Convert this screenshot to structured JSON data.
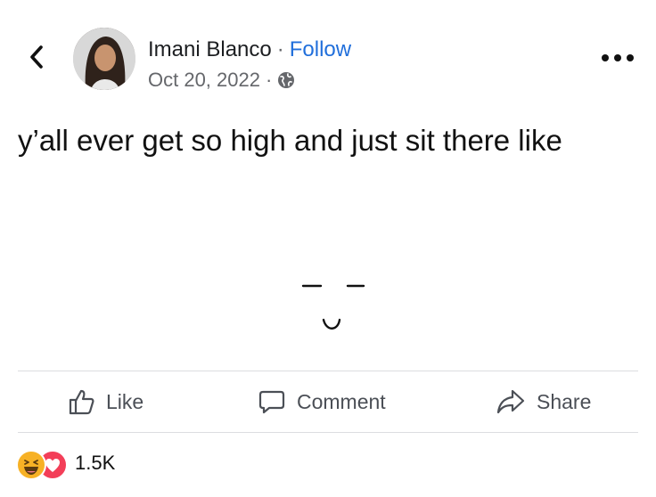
{
  "post": {
    "author": "Imani Blanco",
    "separator": "·",
    "follow_label": "Follow",
    "date": "Oct 20, 2022",
    "date_separator": "·",
    "privacy_icon": "globe-icon",
    "text": "y’all ever get so high and just sit there like"
  },
  "actions": {
    "like_label": "Like",
    "comment_label": "Comment",
    "share_label": "Share"
  },
  "reactions": {
    "count": "1.5K",
    "types": [
      "haha",
      "love"
    ]
  },
  "colors": {
    "accent": "#216fdb",
    "secondary_text": "#65676b",
    "love": "#f33e58",
    "haha": "#f7b125"
  }
}
